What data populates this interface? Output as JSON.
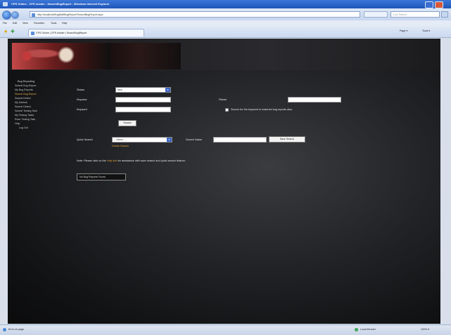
{
  "browser": {
    "title": "CPS Online - CPS Insider - SearchBugReport - Windows Internet Explorer",
    "address": "http://localhost/BugMultiBugReport/SearchBugReport.aspx",
    "search_placeholder": "Live Search",
    "menu": [
      "File",
      "Edit",
      "View",
      "Favorites",
      "Tools",
      "Help"
    ],
    "tab_label": "CPS Online | CPS Insider | SearchBugReport",
    "tools": [
      "Page ▾",
      "Tools ▾"
    ],
    "status_left": "Error on page.",
    "status_zone": "Local intranet",
    "status_zoom": "100% ▾"
  },
  "sidebar": {
    "heading": "Bug Reporting",
    "items": [
      "Submit Bug Report",
      "My Bug Reports",
      "Search Bug Report",
      "Submit Defect",
      "My Defects",
      "Search Defect",
      "Submit Testing Task",
      "My Testing Tasks",
      "Enter Testing Task",
      "Help"
    ],
    "active_index": 2,
    "logout": "Log Out"
  },
  "form": {
    "status_label": "Status",
    "status_value": "New",
    "reporter_label": "Reporter",
    "keyword_label": "Keyword",
    "filesel_label": "Filesel",
    "checkbox_label": "Search for the keyword in matched bug reports also.",
    "search_button": "Search",
    "quick_search_label": "Quick Search",
    "quick_search_value": "-- Select --",
    "delete_search_link": "Delete Search",
    "search_name_label": "Search Name",
    "save_search_button": "Save Search",
    "note_prefix": "Note: Please click on the ",
    "note_link": "Help link",
    "note_suffix": " for assistance with save search and quick search feature.",
    "no_results": "No Bug Reports Found"
  }
}
